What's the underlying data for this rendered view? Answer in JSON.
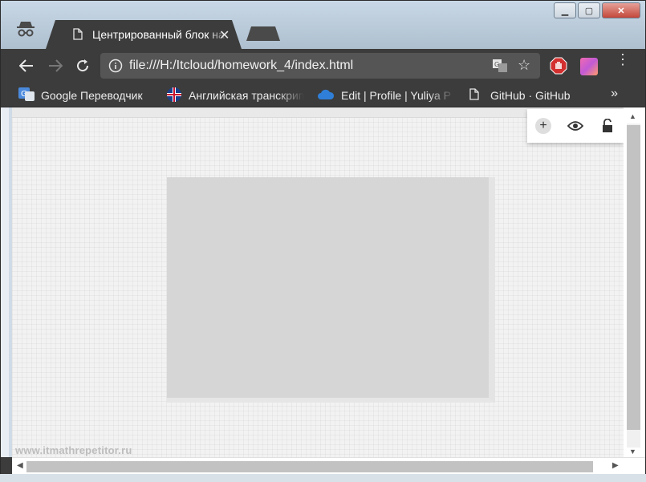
{
  "tab": {
    "title": "Центрированный блок на CSS",
    "close_glyph": "✕"
  },
  "window_controls": {
    "minimize": "▁",
    "maximize": "▢",
    "close": "✕"
  },
  "toolbar": {
    "url": "file:///H:/Itcloud/homework_4/index.html",
    "star_glyph": "☆",
    "menu_glyph": "⋮"
  },
  "bookmarks": [
    {
      "label": "Google Переводчик",
      "icon": "google-translate-icon"
    },
    {
      "label": "Английская транскрипция",
      "icon": "uk-flag-icon"
    },
    {
      "label": "Edit | Profile | Yuliya P",
      "icon": "cloud-icon"
    },
    {
      "label": "GitHub · GitHub",
      "icon": "document-icon"
    }
  ],
  "bookmarks_more": "»",
  "extension_panel": {
    "plus": "+"
  },
  "watermark": "www.itmathrepetitor.ru",
  "colors": {
    "chrome_dark": "#3c3c3c",
    "omnibox": "#555555",
    "block": "#d6d6d6",
    "page_bg": "#f2f2f2"
  }
}
